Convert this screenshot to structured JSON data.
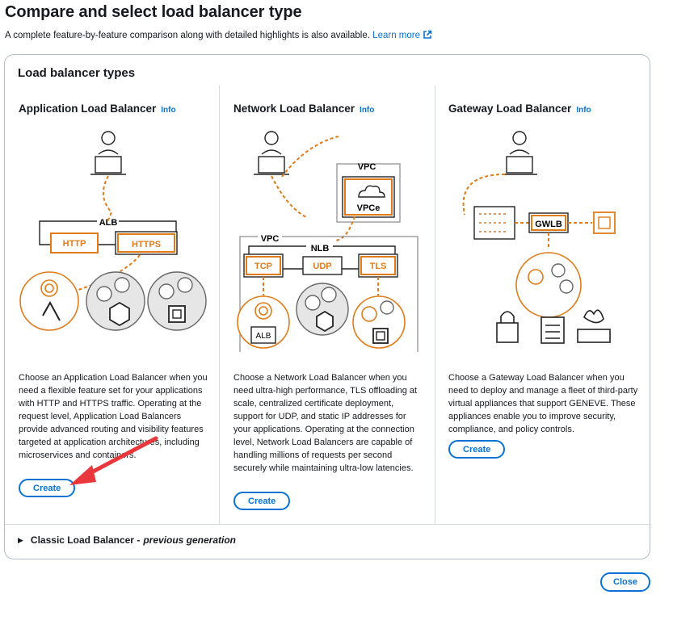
{
  "page": {
    "title": "Compare and select load balancer type",
    "subtitle": "A complete feature-by-feature comparison along with detailed highlights is also available.",
    "learn_more": "Learn more"
  },
  "panel": {
    "header": "Load balancer types",
    "columns": [
      {
        "title": "Application Load Balancer",
        "info": "Info",
        "diagram": {
          "group": "ALB",
          "protocols": [
            "HTTP",
            "HTTPS"
          ]
        },
        "description": "Choose an Application Load Balancer when you need a flexible feature set for your applications with HTTP and HTTPS traffic. Operating at the request level, Application Load Balancers provide advanced routing and visibility features targeted at application architectures, including microservices and containers.",
        "create": "Create"
      },
      {
        "title": "Network Load Balancer",
        "info": "Info",
        "diagram": {
          "outer": "VPC",
          "endpoint": "VPCe",
          "vpc": "VPC",
          "group": "NLB",
          "protocols": [
            "TCP",
            "UDP",
            "TLS"
          ],
          "target": "ALB"
        },
        "description": "Choose a Network Load Balancer when you need ultra-high performance, TLS offloading at scale, centralized certificate deployment, support for UDP, and static IP addresses for your applications. Operating at the connection level, Network Load Balancers are capable of handling millions of requests per second securely while maintaining ultra-low latencies.",
        "create": "Create"
      },
      {
        "title": "Gateway Load Balancer",
        "info": "Info",
        "diagram": {
          "node": "GWLB"
        },
        "description": "Choose a Gateway Load Balancer when you need to deploy and manage a fleet of third-party virtual appliances that support GENEVE. These appliances enable you to improve security, compliance, and policy controls.",
        "create": "Create"
      }
    ],
    "classic": {
      "label": "Classic Load Balancer -",
      "note": "previous generation"
    }
  },
  "footer": {
    "close": "Close"
  },
  "colors": {
    "accent": "#0972d3",
    "orange": "#e07b18",
    "annotation_arrow": "#e8383d"
  }
}
